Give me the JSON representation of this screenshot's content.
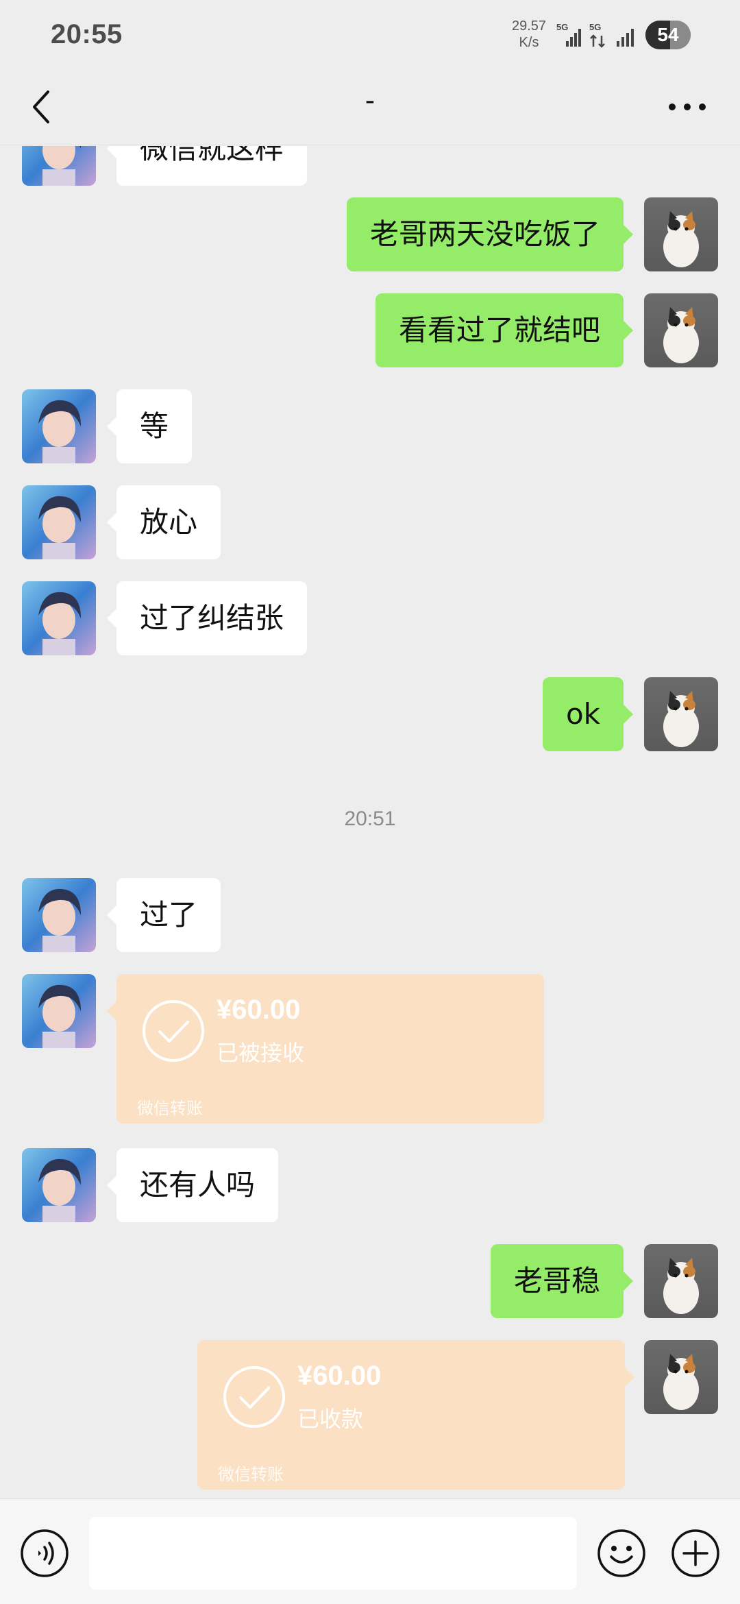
{
  "status_bar": {
    "time": "20:55",
    "net_speed_value": "29.57",
    "net_speed_unit": "K/s",
    "sim1_label": "5G",
    "sim2_label": "5G",
    "battery_level": "54"
  },
  "nav": {
    "title": "-"
  },
  "messages": {
    "m0": "微信就这样",
    "m1": "老哥两天没吃饭了",
    "m2": "看看过了就结吧",
    "m3": "等",
    "m4": "放心",
    "m5": "过了纠结张",
    "m6": "ok",
    "timestamp": "20:51",
    "m7": "过了",
    "m9": "还有人吗",
    "m10": "老哥稳"
  },
  "transfers": {
    "t1": {
      "amount": "¥60.00",
      "status": "已被接收",
      "label": "微信转账"
    },
    "t2": {
      "amount": "¥60.00",
      "status": "已收款",
      "label": "微信转账"
    }
  },
  "input_bar": {
    "placeholder": ""
  },
  "icons": {
    "back": "chevron-left-icon",
    "more": "more-dots-icon",
    "voice": "voice-icon",
    "emoji": "emoji-icon",
    "plus": "plus-icon",
    "check": "check-circle-icon"
  },
  "colors": {
    "outgoing_bubble": "#95ec69",
    "incoming_bubble": "#ffffff",
    "transfer_bubble": "#fbe0c3",
    "background": "#ededed"
  }
}
